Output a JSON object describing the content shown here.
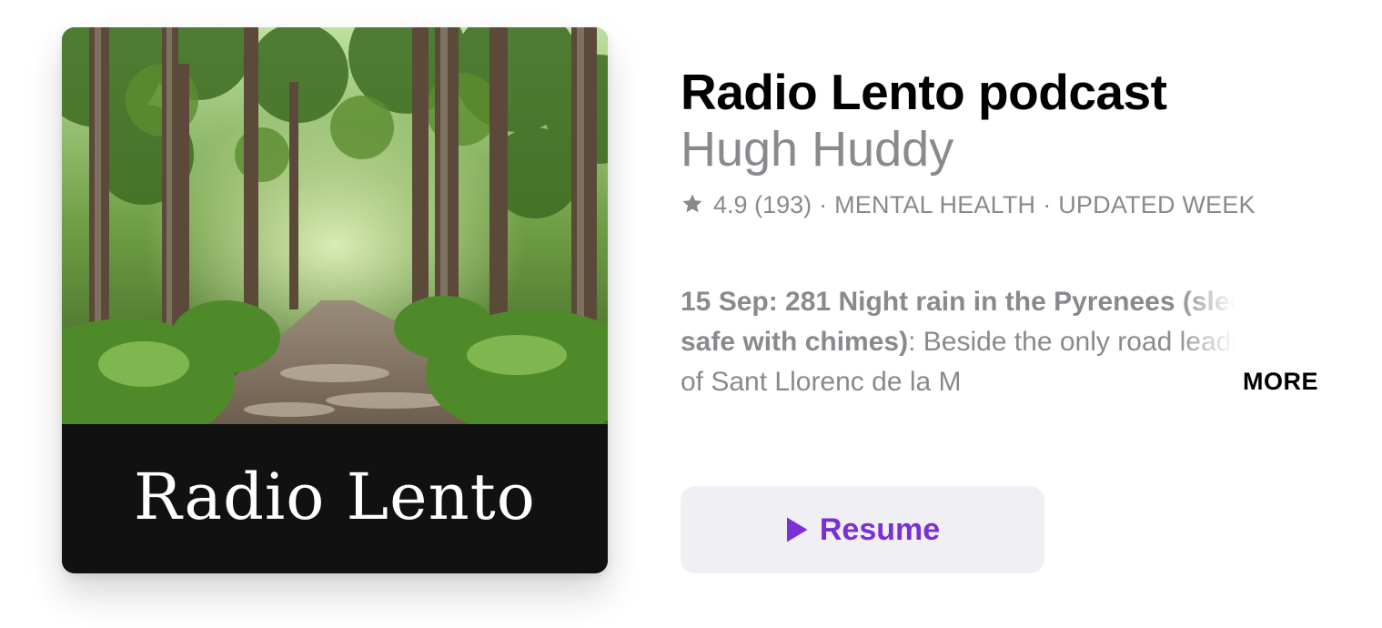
{
  "artwork": {
    "title_text": "Radio Lento"
  },
  "podcast": {
    "title": "Radio Lento podcast",
    "author": "Hugh Huddy",
    "rating": "4.9",
    "rating_count": "(193)",
    "separator": "·",
    "category": "MENTAL HEALTH",
    "update_frequency": "UPDATED WEEK",
    "star_icon": "star-icon"
  },
  "episode": {
    "date_title": "15 Sep: 281 Night rain in the Pyrenees (sleep safe with chimes)",
    "description": ": Beside the only road leading out of Sant Llorenc de la M",
    "more_label": "MORE"
  },
  "actions": {
    "resume_label": "Resume",
    "play_icon": "play-icon"
  },
  "colors": {
    "accent": "#7b2fd6",
    "secondary_text": "#8a8a8e",
    "button_bg": "#efeff4",
    "artwork_band": "#111111"
  }
}
